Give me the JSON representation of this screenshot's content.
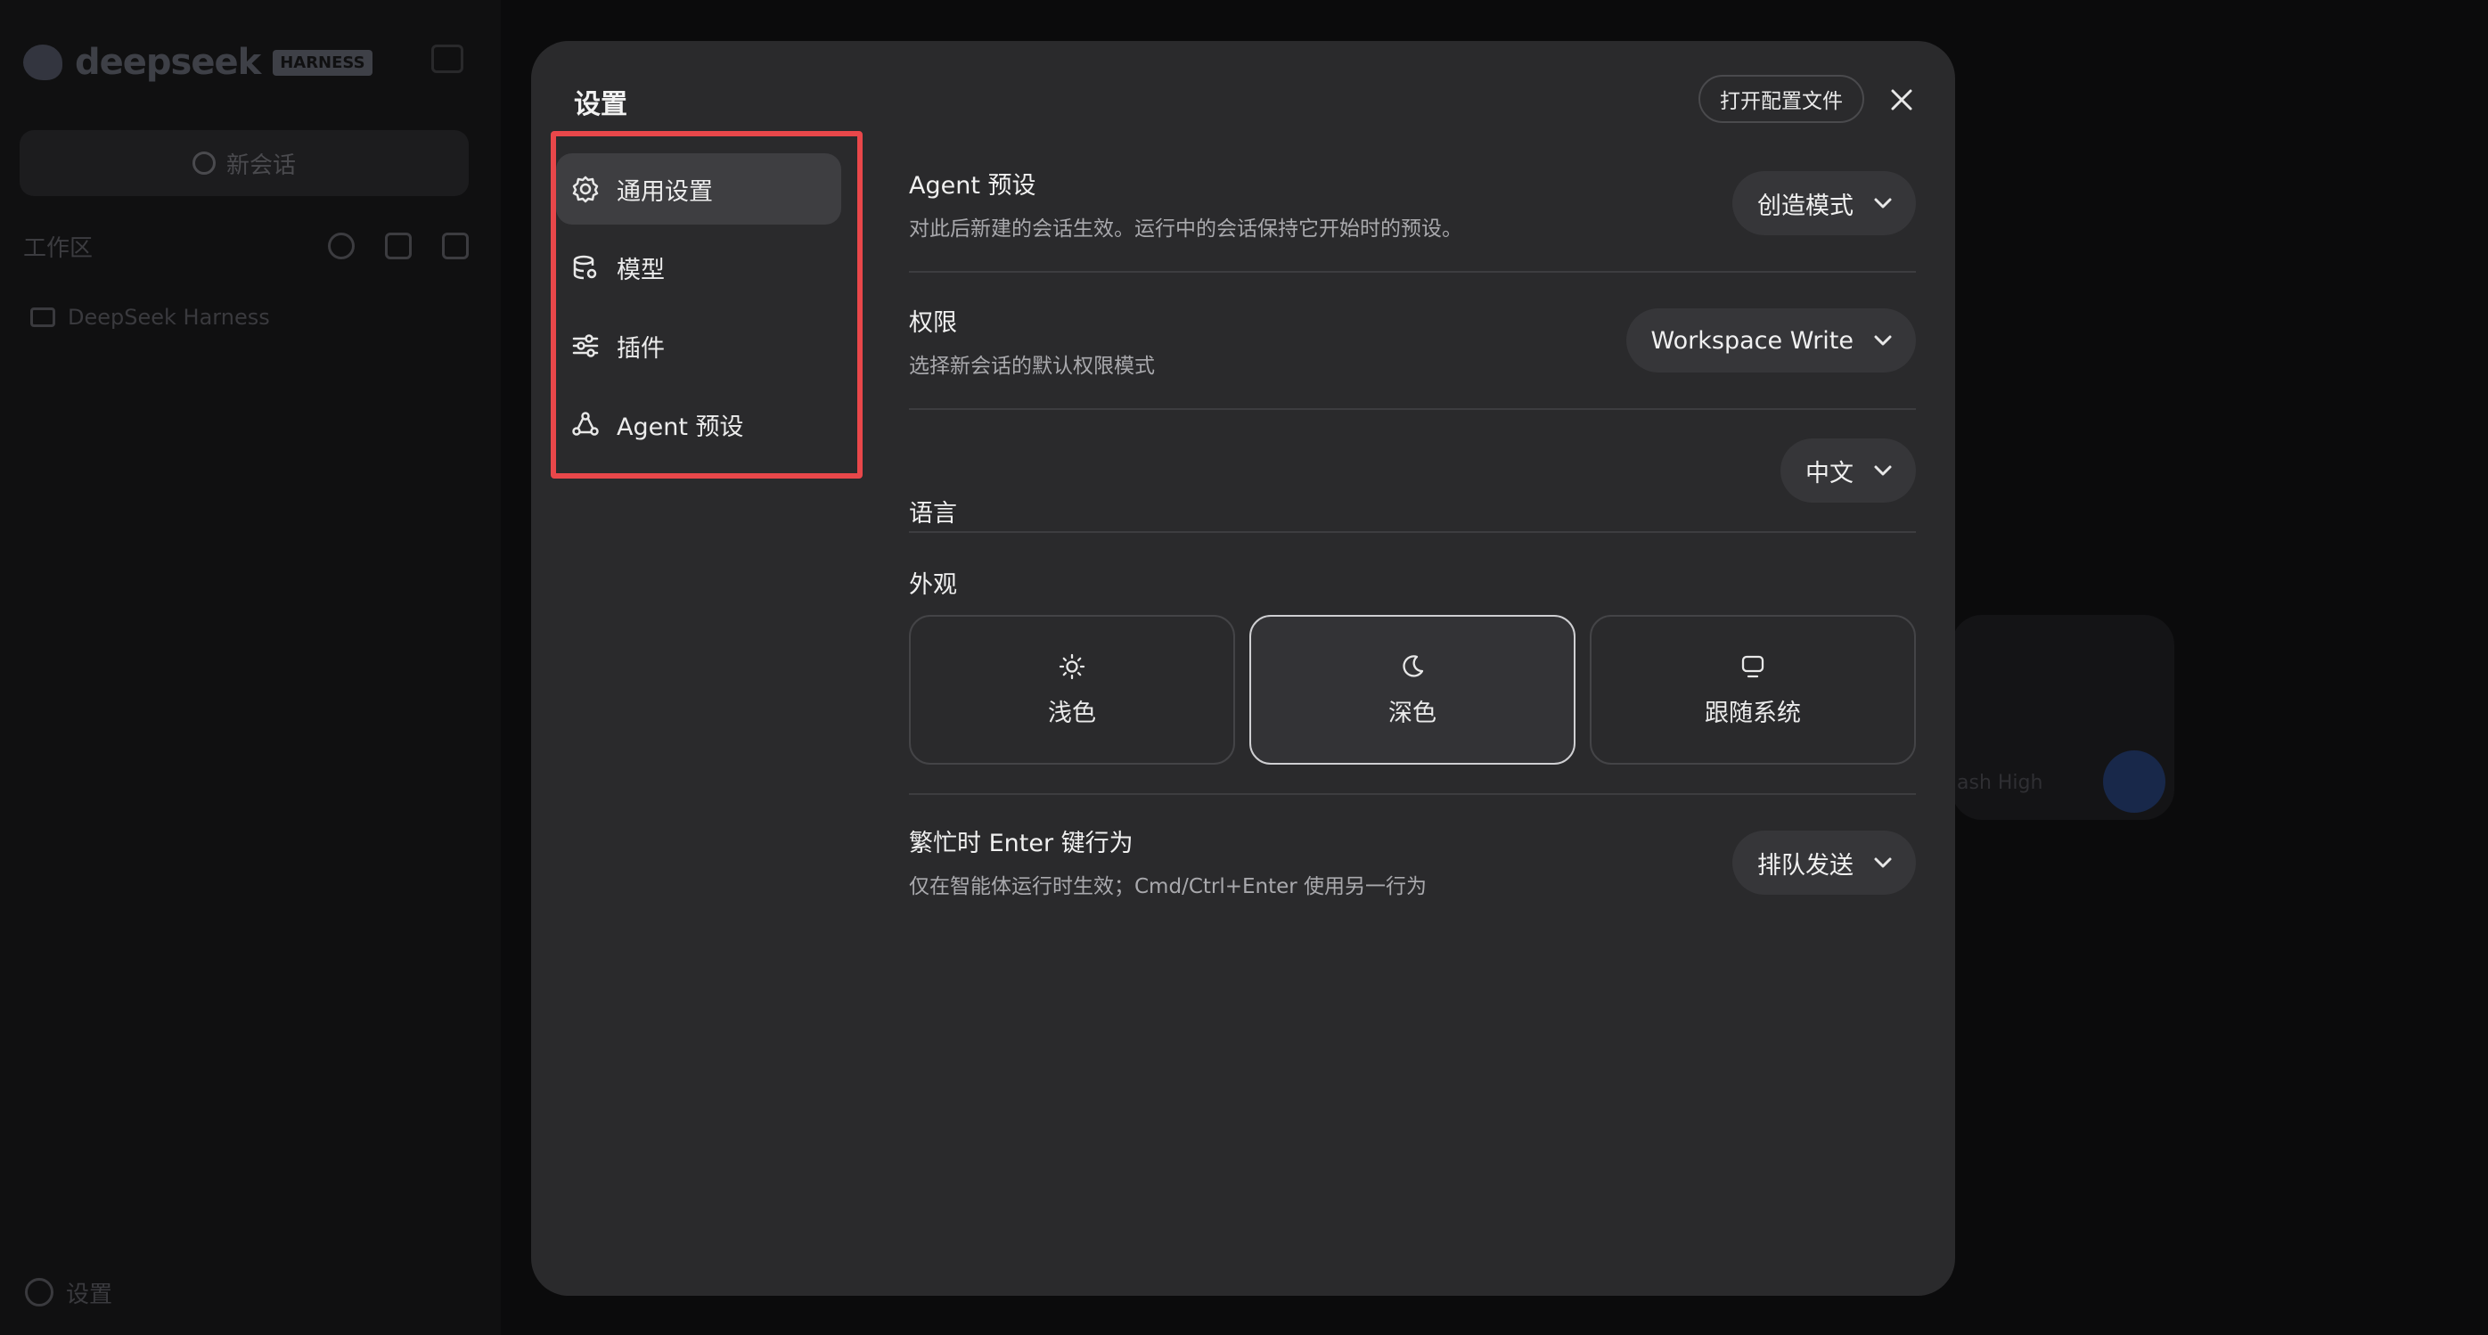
{
  "background": {
    "brand_name": "deepseek",
    "brand_badge": "HARNESS",
    "new_chat_label": "新会话",
    "workspace_label": "工作区",
    "project_name": "DeepSeek Harness",
    "settings_label": "设置",
    "composer_model_label": "ash High"
  },
  "modal": {
    "title": "设置",
    "open_config_label": "打开配置文件",
    "nav": [
      {
        "label": "通用设置",
        "icon": "gear-icon",
        "active": true
      },
      {
        "label": "模型",
        "icon": "database-icon",
        "active": false
      },
      {
        "label": "插件",
        "icon": "sliders-icon",
        "active": false
      },
      {
        "label": "Agent 预设",
        "icon": "agent-icon",
        "active": false
      }
    ],
    "agent_preset": {
      "title": "Agent 预设",
      "desc": "对此后新建的会话生效。运行中的会话保持它开始时的预设。",
      "value": "创造模式"
    },
    "permissions": {
      "title": "权限",
      "desc": "选择新会话的默认权限模式",
      "value": "Workspace Write"
    },
    "language": {
      "title": "语言",
      "value": "中文"
    },
    "appearance": {
      "title": "外观",
      "options": [
        {
          "label": "浅色",
          "icon": "sun-icon",
          "selected": false
        },
        {
          "label": "深色",
          "icon": "moon-icon",
          "selected": true
        },
        {
          "label": "跟随系统",
          "icon": "monitor-icon",
          "selected": false
        }
      ]
    },
    "busy_enter": {
      "title": "繁忙时 Enter 键行为",
      "desc": "仅在智能体运行时生效；Cmd/Ctrl+Enter 使用另一行为",
      "value": "排队发送"
    }
  },
  "colors": {
    "modal_bg": "#2a2a2c",
    "highlight": "#e8474a",
    "active_nav": "#3e3e41"
  }
}
